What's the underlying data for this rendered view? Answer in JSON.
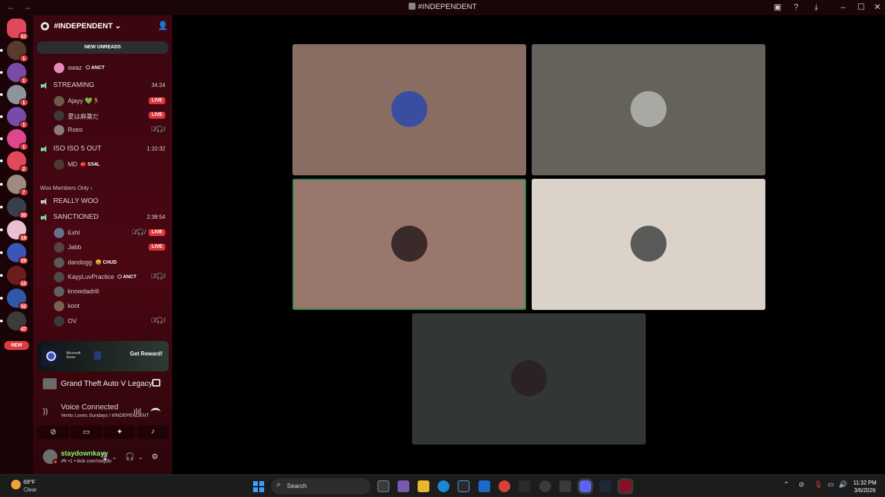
{
  "window": {
    "title": "#INDEPENDENT",
    "back": "←",
    "forward": "→"
  },
  "titlebar_icons": [
    "inbox-icon",
    "help-icon",
    "download-icon",
    "minimize-icon",
    "maximize-icon",
    "close-icon"
  ],
  "servers": [
    {
      "badge": "51",
      "color": "#e0495a"
    },
    {
      "badge": "1",
      "color": "#5a3a2e"
    },
    {
      "badge": "1",
      "color": "#7a4aa8"
    },
    {
      "badge": "1",
      "color": "#8f949c"
    },
    {
      "badge": "1",
      "color": "#7a4aa8"
    },
    {
      "badge": "1",
      "color": "#e0468c"
    },
    {
      "badge": "2",
      "color": "#e0495a"
    },
    {
      "badge": "7",
      "color": "#a08a80"
    },
    {
      "badge": "30",
      "color": "#39404c"
    },
    {
      "badge": "18",
      "color": "#e8c0d0"
    },
    {
      "badge": "29",
      "color": "#3b55b8"
    },
    {
      "badge": "10",
      "color": "#6b1e1e"
    },
    {
      "badge": "52",
      "color": "#2f58a8"
    },
    {
      "badge": "47",
      "color": "#3c3c3c"
    }
  ],
  "new_pill": "NEW",
  "server_header": {
    "name": "#INDEPENDENT",
    "chevron": "⌄"
  },
  "new_unreads": "NEW UNREADS",
  "channels": {
    "partial_user": {
      "name": "swaz",
      "tag": "ANCT"
    },
    "streaming": {
      "name": "STREAMING",
      "duration": "34:24",
      "members": [
        {
          "name": "Ajayy",
          "suffix": "💚🏃",
          "live": "LIVE"
        },
        {
          "name": "愛は麻薬だ",
          "live": "LIVE"
        },
        {
          "name": "Rxtro",
          "muted": "🎙̸🎧̸"
        }
      ]
    },
    "iso": {
      "name": "ISO ISO 5 OUT",
      "duration": "1:10:32",
      "members": [
        {
          "name": "MD",
          "tag": "SS4L"
        }
      ]
    },
    "category": "Woo Members Only",
    "really_woo": {
      "name": "REALLY WOO"
    },
    "sanctioned": {
      "name": "SANCTIONED",
      "duration": "2:38:54",
      "members": [
        {
          "name": "Ꮛxhl",
          "live": "LIVE",
          "muted": "🎙̸🎧̸"
        },
        {
          "name": "Jabb",
          "live": "LIVE"
        },
        {
          "name": "dandogg",
          "tag": "CHUD"
        },
        {
          "name": "KayyLuvPractice",
          "tag": "ANCT",
          "muted": "🎙̸🎧̸"
        },
        {
          "name": "knowdadrill"
        },
        {
          "name": "koot"
        },
        {
          "name": "OV",
          "muted": "🎙̸🎧̸"
        }
      ]
    }
  },
  "ad": {
    "brand_line1": "Microsoft",
    "brand_line2": "Azure",
    "cta": "Get Reward!"
  },
  "activity": {
    "game": "Grand Theft Auto V Legacy"
  },
  "voice": {
    "status": "Voice Connected",
    "location": "Vertio Loves Sundays / #INDEPENDENT"
  },
  "user": {
    "name": "staydownkayy",
    "status": "🎮 •1 • kick.com/staydo"
  },
  "video_tiles": [
    {
      "bg": "#8a6d62",
      "avatar": "#3a4ea0",
      "speaking": false
    },
    {
      "bg": "#65625b",
      "avatar": "#a9a9a3",
      "speaking": false
    },
    {
      "bg": "#99776c",
      "avatar": "#3a2a2a",
      "speaking": true
    },
    {
      "bg": "#dbd3c9",
      "avatar": "#5a5a58",
      "speaking": false
    },
    {
      "bg": "#323637",
      "avatar": "#2a2224",
      "speaking": false
    }
  ],
  "taskbar": {
    "temp": "69°F",
    "condition": "Clear",
    "search": "Search",
    "time": "11:32 PM",
    "date": "3/6/2026"
  }
}
